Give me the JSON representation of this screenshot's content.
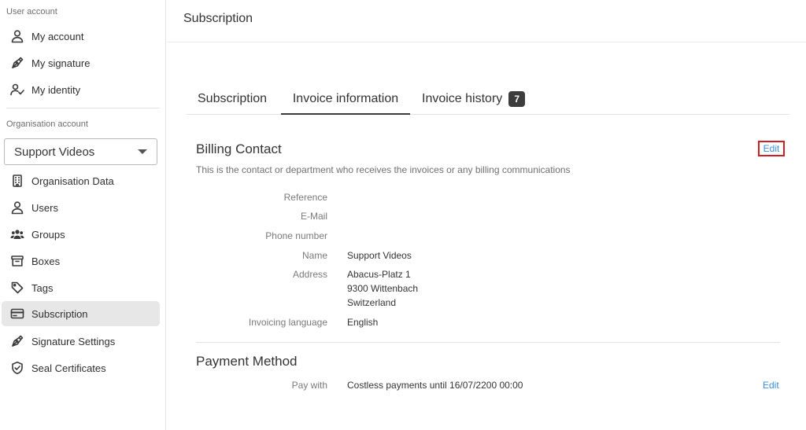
{
  "sidebar": {
    "user_section_label": "User account",
    "user_items": [
      {
        "label": "My account",
        "icon": "user-icon"
      },
      {
        "label": "My signature",
        "icon": "pen-nib-icon"
      },
      {
        "label": "My identity",
        "icon": "user-check-icon"
      }
    ],
    "org_section_label": "Organisation account",
    "org_select": {
      "value": "Support Videos"
    },
    "org_items": [
      {
        "label": "Organisation Data",
        "icon": "building-icon"
      },
      {
        "label": "Users",
        "icon": "user-icon"
      },
      {
        "label": "Groups",
        "icon": "users-group-icon"
      },
      {
        "label": "Boxes",
        "icon": "archive-box-icon"
      },
      {
        "label": "Tags",
        "icon": "tag-icon"
      },
      {
        "label": "Subscription",
        "icon": "credit-card-icon",
        "active": true
      },
      {
        "label": "Signature Settings",
        "icon": "pen-nib-icon"
      },
      {
        "label": "Seal Certificates",
        "icon": "shield-check-icon"
      }
    ]
  },
  "header": {
    "title": "Subscription"
  },
  "tabs": [
    {
      "label": "Subscription"
    },
    {
      "label": "Invoice information",
      "active": true
    },
    {
      "label": "Invoice history",
      "badge": "7"
    }
  ],
  "billing": {
    "title": "Billing Contact",
    "description": "This is the contact or department who receives the invoices or any billing communications",
    "edit_label": "Edit",
    "fields": {
      "reference_label": "Reference",
      "email_label": "E-Mail",
      "phone_label": "Phone number",
      "name_label": "Name",
      "name_value": "Support Videos",
      "address_label": "Address",
      "address_line1": "Abacus-Platz 1",
      "address_line2": "9300 Wittenbach",
      "address_line3": "Switzerland",
      "language_label": "Invoicing language",
      "language_value": "English"
    }
  },
  "payment": {
    "title": "Payment Method",
    "pay_with_label": "Pay with",
    "pay_with_value": "Costless payments until 16/07/2200 00:00",
    "edit_label": "Edit"
  },
  "colors": {
    "link": "#3c8ddf",
    "highlight_border": "#d01f24",
    "active_nav_bg": "#e7e7e7",
    "badge_bg": "#3d3d3d"
  }
}
